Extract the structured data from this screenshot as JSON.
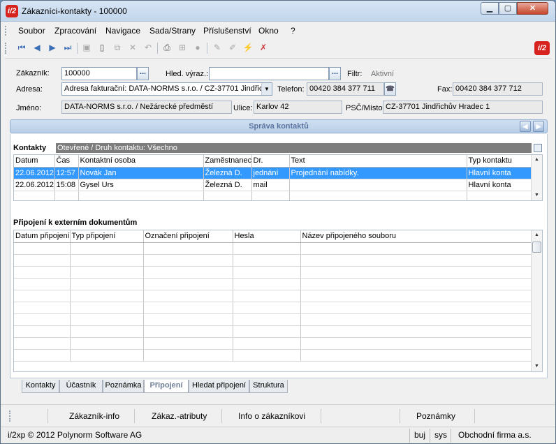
{
  "window": {
    "title": "Zákazníci-kontakty - 100000",
    "logo": "i/2"
  },
  "menu": [
    "Soubor",
    "Zpracování",
    "Navigace",
    "Sada/Strany",
    "Příslušenství",
    "Okno",
    "?"
  ],
  "toolbar_icons": [
    "first-icon",
    "prev-icon",
    "next-icon",
    "last-icon",
    "save-icon",
    "new-icon",
    "copy-icon",
    "delete-icon",
    "undo-icon",
    "print-icon",
    "tree-icon",
    "stop-icon",
    "edit-icon",
    "edit2-icon",
    "filter-icon",
    "clear-filter-icon"
  ],
  "form": {
    "zakaznik_label": "Zákazník:",
    "zakaznik_value": "100000",
    "hled_label": "Hled. výraz.:",
    "hled_value": "",
    "filtr_label": "Filtr:",
    "filtr_value": "Aktivní",
    "adresa_label": "Adresa:",
    "adresa_value": "Adresa fakturační: DATA-NORMS s.r.o. / CZ-37701 Jindřic",
    "telefon_label": "Telefon:",
    "telefon_value": "00420 384 377 711",
    "fax_label": "Fax:",
    "fax_value": "00420 384 377 712",
    "jmeno_label": "Jméno:",
    "jmeno_value": "DATA-NORMS s.r.o. / Nežárecké předměstí",
    "ulice_label": "Ulice:",
    "ulice_value": "Karlov 42",
    "psc_label": "PSČ/Místo:",
    "psc_value": "CZ-37701 Jindřichův Hradec 1",
    "dots": "..."
  },
  "panel": {
    "title": "Správa kontaktů"
  },
  "contacts": {
    "title": "Kontakty",
    "status": "Otevřené / Druh kontaktu: Všechno",
    "columns": [
      "Datum",
      "Čas",
      "Kontaktní osoba",
      "Zaměstnanec",
      "Dr.",
      "Text",
      "Typ kontaktu"
    ],
    "rows": [
      [
        "22.06.2012",
        "12:57",
        "Novák Jan",
        "Železná D.",
        "jednání",
        "Projednání nabídky.",
        "Hlavní konta"
      ],
      [
        "22.06.2012",
        "15:08",
        "Gysel Urs",
        "Železná D.",
        "mail",
        "",
        "Hlavní konta"
      ]
    ]
  },
  "documents": {
    "title": "Připojení k externím dokumentům",
    "columns": [
      "Datum připojení",
      "Typ připojení",
      "Označení připojení",
      "Hesla",
      "Název připojeného souboru"
    ]
  },
  "tabs": [
    "Kontakty",
    "Účastník",
    "Poznámka",
    "Připojení",
    "Hledat připojení",
    "Struktura"
  ],
  "active_tab": "Připojení",
  "bottom_buttons": [
    "Zákazník-info",
    "Zákaz.-atributy",
    "Info o zákazníkovi",
    "Poznámky"
  ],
  "statusbar": {
    "copyright": "i/2xp © 2012 Polynorm Software AG",
    "mode": "buj",
    "user": "sys",
    "company": "Obchodní firma a.s."
  }
}
